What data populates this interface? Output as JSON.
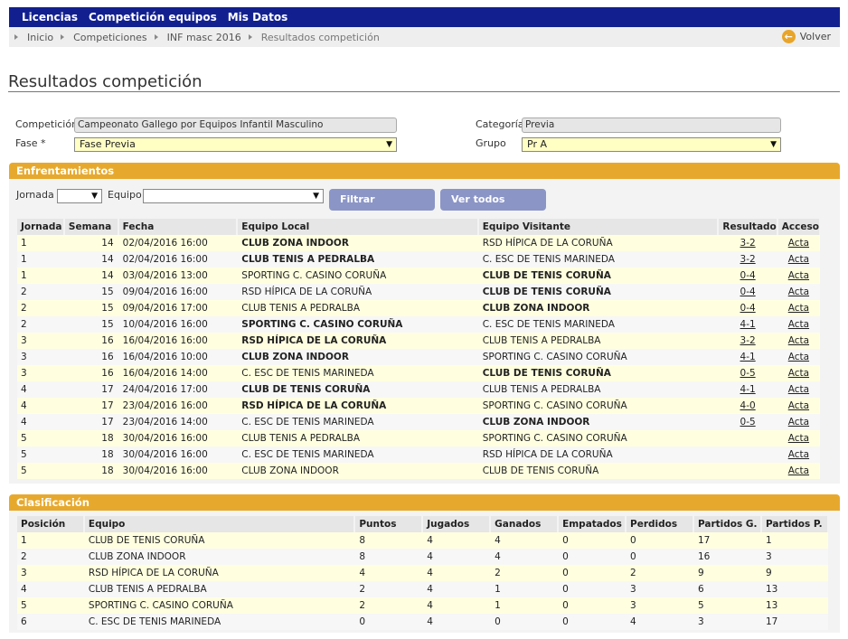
{
  "nav": {
    "items": [
      "Licencias",
      "Competición equipos",
      "Mis Datos"
    ]
  },
  "breadcrumb": {
    "items": [
      "Inicio",
      "Competiciones",
      "INF masc 2016",
      "Resultados competición"
    ],
    "back_label": "Volver"
  },
  "page": {
    "title": "Resultados competición"
  },
  "form": {
    "competicion_label": "Competición",
    "competicion_value": "Campeonato Gallego por Equipos Infantil Masculino",
    "categoria_label": "Categoría",
    "categoria_value": "Previa",
    "fase_label": "Fase *",
    "fase_value": "Fase Previa",
    "grupo_label": "Grupo",
    "grupo_value": "Pr A"
  },
  "enfrentamientos": {
    "title": "Enfrentamientos",
    "jornada_label": "Jornada",
    "equipo_label": "Equipo",
    "filtrar_label": "Filtrar",
    "ver_todos_label": "Ver todos",
    "columns": [
      "Jornada",
      "Semana",
      "Fecha",
      "Equipo Local",
      "Equipo Visitante",
      "Resultado",
      "Acceso"
    ],
    "rows": [
      {
        "jornada": "1",
        "semana": "14",
        "fecha": "02/04/2016 16:00",
        "local": "CLUB ZONA INDOOR",
        "visitante": "RSD HÍPICA DE LA CORUÑA",
        "resultado": "3-2",
        "acceso": "Acta",
        "winner": "local"
      },
      {
        "jornada": "1",
        "semana": "14",
        "fecha": "02/04/2016 16:00",
        "local": "CLUB TENIS A PEDRALBA",
        "visitante": "C. ESC DE TENIS MARINEDA",
        "resultado": "3-2",
        "acceso": "Acta",
        "winner": "local"
      },
      {
        "jornada": "1",
        "semana": "14",
        "fecha": "03/04/2016 13:00",
        "local": "SPORTING C. CASINO CORUÑA",
        "visitante": "CLUB DE TENIS CORUÑA",
        "resultado": "0-4",
        "acceso": "Acta",
        "winner": "visitante"
      },
      {
        "jornada": "2",
        "semana": "15",
        "fecha": "09/04/2016 16:00",
        "local": "RSD HÍPICA DE LA CORUÑA",
        "visitante": "CLUB DE TENIS CORUÑA",
        "resultado": "0-4",
        "acceso": "Acta",
        "winner": "visitante"
      },
      {
        "jornada": "2",
        "semana": "15",
        "fecha": "09/04/2016 17:00",
        "local": "CLUB TENIS A PEDRALBA",
        "visitante": "CLUB ZONA INDOOR",
        "resultado": "0-4",
        "acceso": "Acta",
        "winner": "visitante"
      },
      {
        "jornada": "2",
        "semana": "15",
        "fecha": "10/04/2016 16:00",
        "local": "SPORTING C. CASINO CORUÑA",
        "visitante": "C. ESC DE TENIS MARINEDA",
        "resultado": "4-1",
        "acceso": "Acta",
        "winner": "local"
      },
      {
        "jornada": "3",
        "semana": "16",
        "fecha": "16/04/2016 16:00",
        "local": "RSD HÍPICA DE LA CORUÑA",
        "visitante": "CLUB TENIS A PEDRALBA",
        "resultado": "3-2",
        "acceso": "Acta",
        "winner": "local"
      },
      {
        "jornada": "3",
        "semana": "16",
        "fecha": "16/04/2016 10:00",
        "local": "CLUB ZONA INDOOR",
        "visitante": "SPORTING C. CASINO CORUÑA",
        "resultado": "4-1",
        "acceso": "Acta",
        "winner": "local"
      },
      {
        "jornada": "3",
        "semana": "16",
        "fecha": "16/04/2016 14:00",
        "local": "C. ESC DE TENIS MARINEDA",
        "visitante": "CLUB DE TENIS CORUÑA",
        "resultado": "0-5",
        "acceso": "Acta",
        "winner": "visitante"
      },
      {
        "jornada": "4",
        "semana": "17",
        "fecha": "24/04/2016 17:00",
        "local": "CLUB DE TENIS CORUÑA",
        "visitante": "CLUB TENIS A PEDRALBA",
        "resultado": "4-1",
        "acceso": "Acta",
        "winner": "local"
      },
      {
        "jornada": "4",
        "semana": "17",
        "fecha": "23/04/2016 16:00",
        "local": "RSD HÍPICA DE LA CORUÑA",
        "visitante": "SPORTING C. CASINO CORUÑA",
        "resultado": "4-0",
        "acceso": "Acta",
        "winner": "local"
      },
      {
        "jornada": "4",
        "semana": "17",
        "fecha": "23/04/2016 14:00",
        "local": "C. ESC DE TENIS MARINEDA",
        "visitante": "CLUB ZONA INDOOR",
        "resultado": "0-5",
        "acceso": "Acta",
        "winner": "visitante"
      },
      {
        "jornada": "5",
        "semana": "18",
        "fecha": "30/04/2016 16:00",
        "local": "CLUB TENIS A PEDRALBA",
        "visitante": "SPORTING C. CASINO CORUÑA",
        "resultado": "",
        "acceso": "Acta",
        "winner": ""
      },
      {
        "jornada": "5",
        "semana": "18",
        "fecha": "30/04/2016 16:00",
        "local": "C. ESC DE TENIS MARINEDA",
        "visitante": "RSD HÍPICA DE LA CORUÑA",
        "resultado": "",
        "acceso": "Acta",
        "winner": ""
      },
      {
        "jornada": "5",
        "semana": "18",
        "fecha": "30/04/2016 16:00",
        "local": "CLUB ZONA INDOOR",
        "visitante": "CLUB DE TENIS CORUÑA",
        "resultado": "",
        "acceso": "Acta",
        "winner": ""
      }
    ]
  },
  "clasificacion": {
    "title": "Clasificación",
    "columns": [
      "Posición",
      "Equipo",
      "Puntos",
      "Jugados",
      "Ganados",
      "Empatados",
      "Perdidos",
      "Partidos G.",
      "Partidos P."
    ],
    "rows": [
      {
        "posicion": "1",
        "equipo": "CLUB DE TENIS CORUÑA",
        "puntos": "8",
        "jugados": "4",
        "ganados": "4",
        "empatados": "0",
        "perdidos": "0",
        "pg": "17",
        "pp": "1"
      },
      {
        "posicion": "2",
        "equipo": "CLUB ZONA INDOOR",
        "puntos": "8",
        "jugados": "4",
        "ganados": "4",
        "empatados": "0",
        "perdidos": "0",
        "pg": "16",
        "pp": "3"
      },
      {
        "posicion": "3",
        "equipo": "RSD HÍPICA DE LA CORUÑA",
        "puntos": "4",
        "jugados": "4",
        "ganados": "2",
        "empatados": "0",
        "perdidos": "2",
        "pg": "9",
        "pp": "9"
      },
      {
        "posicion": "4",
        "equipo": "CLUB TENIS A PEDRALBA",
        "puntos": "2",
        "jugados": "4",
        "ganados": "1",
        "empatados": "0",
        "perdidos": "3",
        "pg": "6",
        "pp": "13"
      },
      {
        "posicion": "5",
        "equipo": "SPORTING C. CASINO CORUÑA",
        "puntos": "2",
        "jugados": "4",
        "ganados": "1",
        "empatados": "0",
        "perdidos": "3",
        "pg": "5",
        "pp": "13"
      },
      {
        "posicion": "6",
        "equipo": "C. ESC DE TENIS MARINEDA",
        "puntos": "0",
        "jugados": "4",
        "ganados": "0",
        "empatados": "0",
        "perdidos": "4",
        "pg": "3",
        "pp": "17"
      }
    ]
  }
}
